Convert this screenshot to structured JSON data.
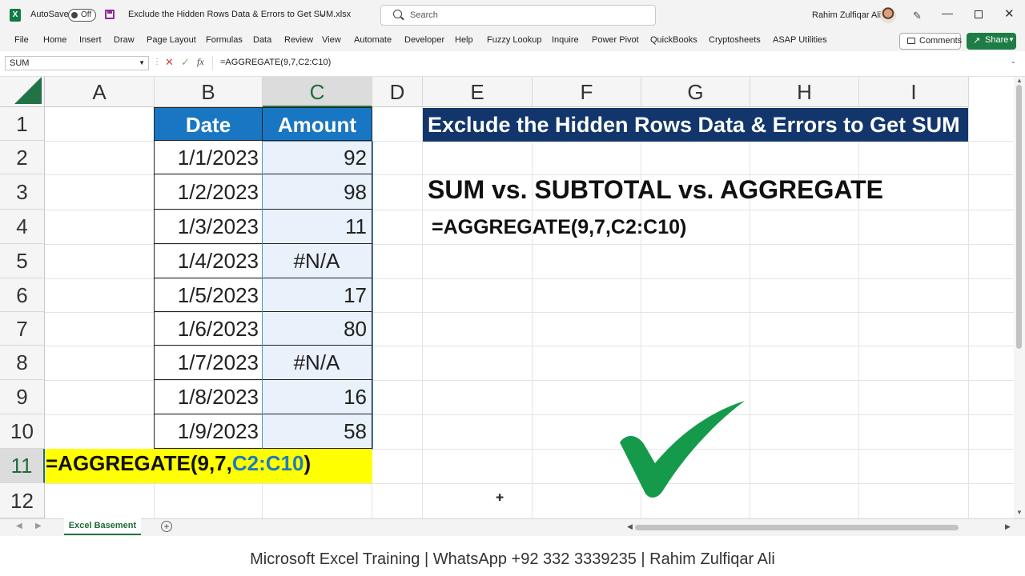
{
  "titlebar": {
    "app_icon_letter": "X",
    "autosave_label": "AutoSave",
    "autosave_state": "Off",
    "file_title": "Exclude the Hidden Rows Data & Errors to Get SUM.xlsx",
    "search_placeholder": "Search",
    "user_name": "Rahim Zulfiqar Ali"
  },
  "menu": [
    "File",
    "Home",
    "Insert",
    "Draw",
    "Page Layout",
    "Formulas",
    "Data",
    "Review",
    "View",
    "Automate",
    "Developer",
    "Help",
    "Fuzzy Lookup",
    "Inquire",
    "Power Pivot",
    "QuickBooks",
    "Cryptosheets",
    "ASAP Utilities"
  ],
  "comments_label": "Comments",
  "share_label": "Share",
  "formula_bar": {
    "name_box": "SUM",
    "formula": "=AGGREGATE(9,7,C2:C10)"
  },
  "columns": [
    "A",
    "B",
    "C",
    "D",
    "E",
    "F",
    "G",
    "H",
    "I"
  ],
  "rows": [
    "1",
    "2",
    "3",
    "4",
    "5",
    "6",
    "7",
    "8",
    "9",
    "10",
    "11",
    "12"
  ],
  "table": {
    "headers": {
      "date": "Date",
      "amount": "Amount"
    },
    "data": [
      {
        "date": "1/1/2023",
        "amount": "92"
      },
      {
        "date": "1/2/2023",
        "amount": "98"
      },
      {
        "date": "1/3/2023",
        "amount": "11"
      },
      {
        "date": "1/4/2023",
        "amount": "#N/A"
      },
      {
        "date": "1/5/2023",
        "amount": "17"
      },
      {
        "date": "1/6/2023",
        "amount": "80"
      },
      {
        "date": "1/7/2023",
        "amount": "#N/A"
      },
      {
        "date": "1/8/2023",
        "amount": "16"
      },
      {
        "date": "1/9/2023",
        "amount": "58"
      }
    ]
  },
  "editing_cell": {
    "prefix": "=AGGREGATE(9,7,",
    "range_ref": "C2:C10",
    "suffix": ")"
  },
  "banner_title": "Exclude the Hidden Rows Data & Errors to Get SUM",
  "heading": "SUM vs. SUBTOTAL vs. AGGREGATE",
  "formula_display": "=AGGREGATE(9,7,C2:C10)",
  "sheet_tab": "Excel Basement",
  "footer": "Microsoft Excel Training | WhatsApp +92 332 3339235 | Rahim Zulfiqar Ali",
  "colors": {
    "header_fill": "#1976c2",
    "banner_fill": "#12366b",
    "edit_fill": "#ffff00",
    "checkmark": "#149a4a",
    "excel_green": "#217346"
  }
}
